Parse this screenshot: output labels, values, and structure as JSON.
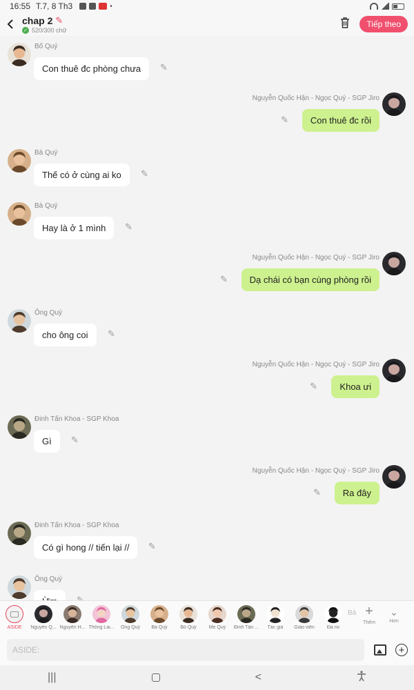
{
  "status": {
    "time": "16:55",
    "date": "T.7, 8 Th3",
    "dot": "•"
  },
  "header": {
    "back_icon": "chevron-left-icon",
    "title": "chap 2",
    "word_count": "520/300 chữ",
    "next_label": "Tiếp theo",
    "accent_color": "#f0506e"
  },
  "messages": [
    {
      "side": "left",
      "name": "Bố Quý",
      "text": "Con thuê đc phòng chưa",
      "avatar": "bo-quy"
    },
    {
      "side": "right",
      "name": "Nguyễn Quốc Hận - Ngọc Quý - SGP Jiro",
      "text": "Con thuê đc rồi",
      "avatar": "nguyen-quoc-han"
    },
    {
      "side": "left",
      "name": "Bà Quý",
      "text": "Thế có ở cùng ai ko",
      "avatar": "ba-quy"
    },
    {
      "side": "left",
      "name": "Bà Quý",
      "text": "Hay là ở 1 mình",
      "avatar": "ba-quy"
    },
    {
      "side": "right",
      "name": "Nguyễn Quốc Hận - Ngọc Quý - SGP Jiro",
      "text": "Dạ chái có bạn cùng phòng rồi",
      "avatar": "nguyen-quoc-han"
    },
    {
      "side": "left",
      "name": "Ông Quý",
      "text": "cho ông coi",
      "avatar": "ong-quy"
    },
    {
      "side": "right",
      "name": "Nguyễn Quốc Hận - Ngọc Quý - SGP Jiro",
      "text": "Khoa ưi",
      "avatar": "nguyen-quoc-han"
    },
    {
      "side": "left",
      "name": "Đinh Tấn Khoa - SGP Khoa",
      "text": "Gì",
      "avatar": "dinh-tan-khoa"
    },
    {
      "side": "right",
      "name": "Nguyễn Quốc Hận - Ngọc Quý - SGP Jiro",
      "text": "Ra đây",
      "avatar": "nguyen-quoc-han"
    },
    {
      "side": "left",
      "name": "Đinh Tấn Khoa - SGP Khoa",
      "text": "Có gì hong // tiến lại //",
      "avatar": "dinh-tan-khoa"
    },
    {
      "side": "left",
      "name": "Ông Quý",
      "text": "Ừm",
      "avatar": "ong-quy"
    }
  ],
  "characters": [
    {
      "name": "ASIDE",
      "avatar": "aside"
    },
    {
      "name": "Nguyễn Q...",
      "avatar": "nguyen-quoc-han"
    },
    {
      "name": "Nguyễn H...",
      "avatar": "nguyen-h"
    },
    {
      "name": "Thông Lai...",
      "avatar": "thong-lai"
    },
    {
      "name": "Ông Quý",
      "avatar": "ong-quy"
    },
    {
      "name": "Bà Quý",
      "avatar": "ba-quy"
    },
    {
      "name": "Bố Quý",
      "avatar": "bo-quy"
    },
    {
      "name": "Mẹ Quý",
      "avatar": "me-quy"
    },
    {
      "name": "Đinh Tấn ...",
      "avatar": "dinh-tan-khoa"
    },
    {
      "name": "Tác giả",
      "avatar": "tac-gia"
    },
    {
      "name": "Giáo viên",
      "avatar": "giao-vien"
    },
    {
      "name": "Đa nv",
      "avatar": "da-nv"
    }
  ],
  "char_fade": "Bà",
  "tools": {
    "add_label": "Thêm",
    "more_label": "Hơn"
  },
  "input": {
    "placeholder": "ASIDE:"
  },
  "colors": {
    "right_bubble": "#cdf18e",
    "left_bubble": "#ffffff",
    "accent": "#e8475e"
  }
}
